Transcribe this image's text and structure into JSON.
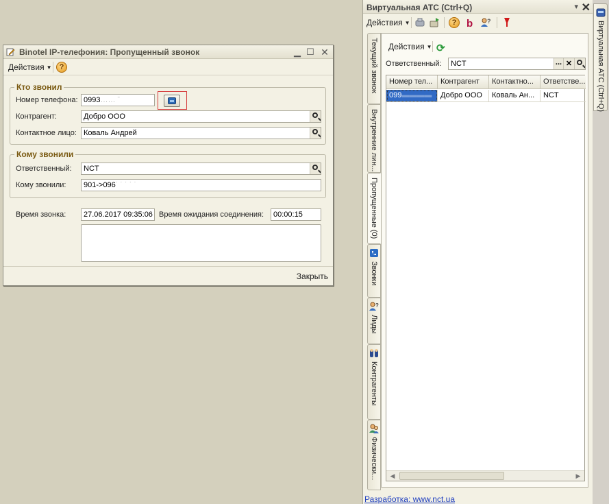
{
  "dialog": {
    "title": "Binotel IP-телефония: Пропущенный звонок",
    "actions_label": "Действия",
    "who_called": {
      "title": "Кто звонил",
      "phone_label": "Номер телефона:",
      "phone_value": "0993",
      "phone_hidden": "……  ˉ",
      "contractor_label": "Контрагент:",
      "contractor_value": "Добро ООО",
      "contact_label": "Контактное лицо:",
      "contact_value": "Коваль Андрей"
    },
    "whom_called": {
      "title": "Кому звонили",
      "responsible_label": "Ответственный:",
      "responsible_value": "NCT",
      "target_label": "Кому звонили:",
      "target_value": "901->096",
      "target_hidden": "˙ ˙ ˙ ˙ ˙"
    },
    "call_time_label": "Время звонка:",
    "call_time_value": "27.06.2017 09:35:06",
    "wait_label": "Время ожидания соединения:",
    "wait_value": "00:00:15",
    "close_label": "Закрыть"
  },
  "panel": {
    "title": "Виртуальная АТС (Ctrl+Q)",
    "pin_label": "▾",
    "close_label": "✕",
    "actions_label": "Действия",
    "inner_actions_label": "Действия",
    "responsible_label": "Ответственный:",
    "responsible_value": "NCT",
    "tabs": [
      {
        "label": "Текущий звонок"
      },
      {
        "label": "Внутренние лин..."
      },
      {
        "label": "Пропущенные (0)"
      },
      {
        "label": "Звонки"
      },
      {
        "label": "Лиды"
      },
      {
        "label": "Контрагенты"
      },
      {
        "label": "Физически..."
      }
    ],
    "table": {
      "columns": [
        "Номер тел...",
        "Контрагент",
        "Контактно...",
        "Ответстве..."
      ],
      "rows": [
        [
          "099",
          "Добро ООО",
          "Коваль  Ан...",
          "NCT"
        ]
      ]
    },
    "footer_link": "Разработка: www.nct.ua"
  },
  "side_tab": {
    "label": "Виртуальная АТС (Ctrl+Q)"
  }
}
